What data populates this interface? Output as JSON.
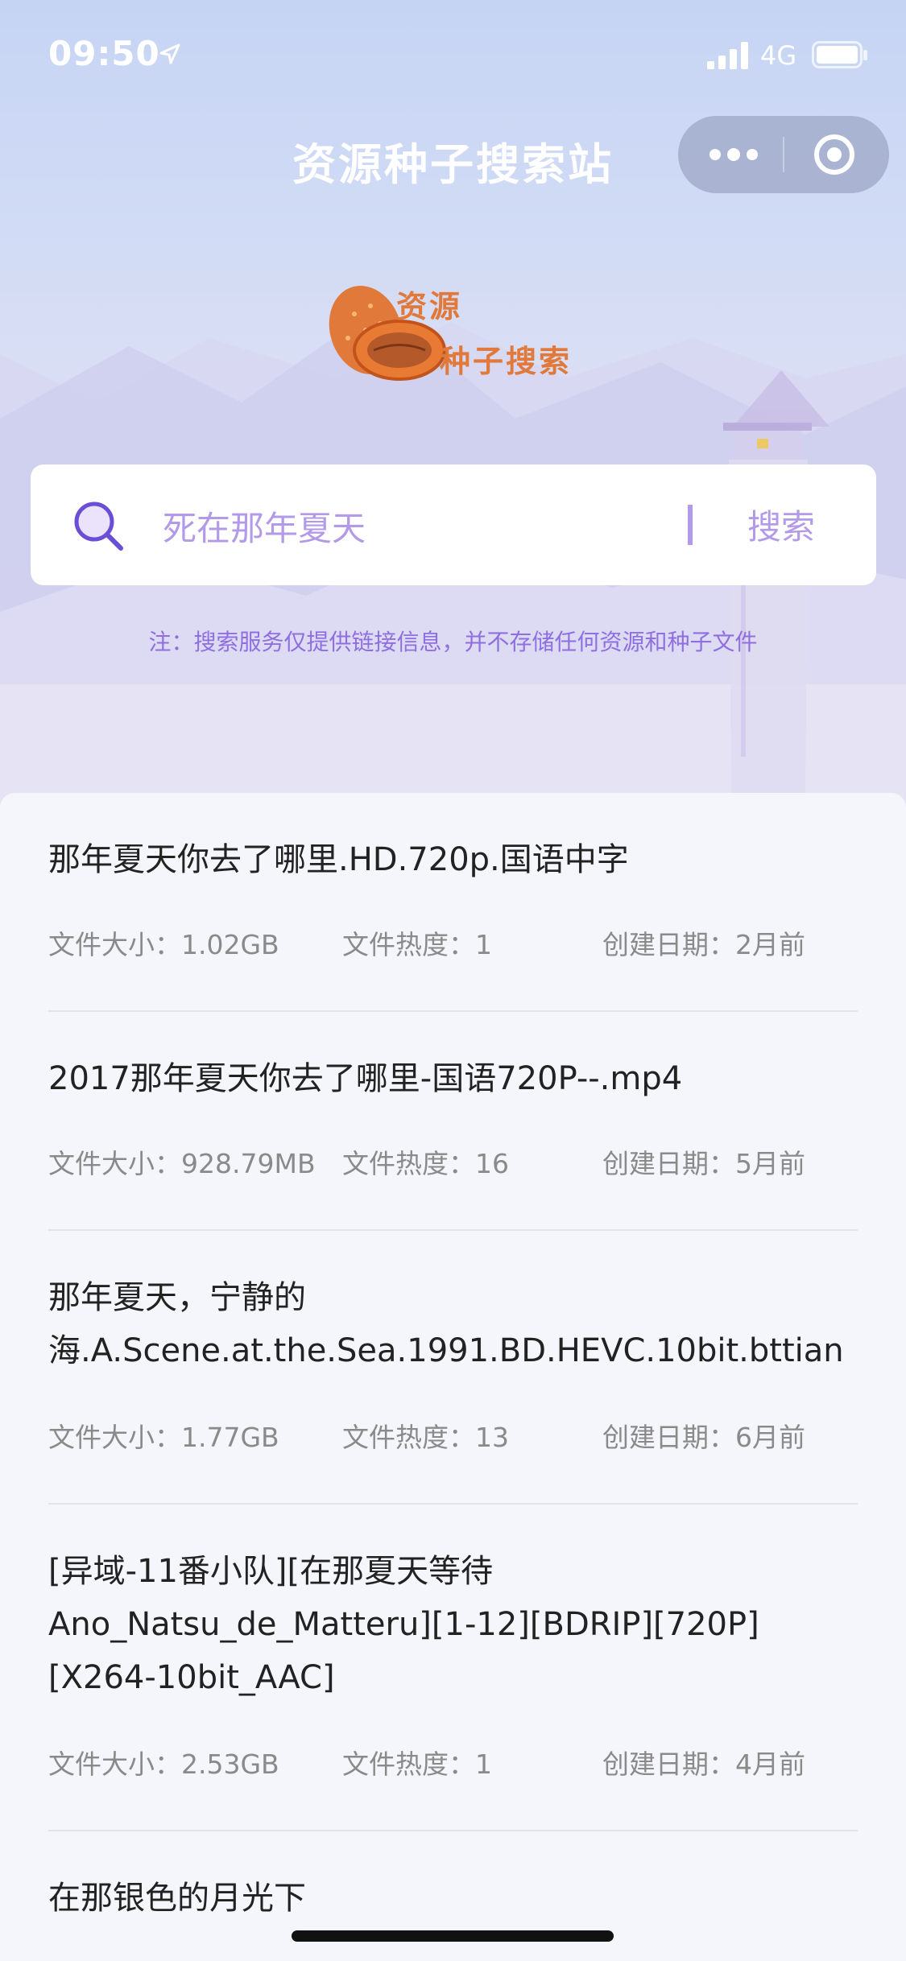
{
  "status_bar": {
    "time": "09:50",
    "network": "4G"
  },
  "nav": {
    "title": "资源种子搜索站"
  },
  "logo": {
    "line1": "资源",
    "line2": "种子搜索"
  },
  "search": {
    "value": "死在那年夏天",
    "button_label": "搜索"
  },
  "note": "注：搜索服务仅提供链接信息，并不存储任何资源和种子文件",
  "meta_labels": {
    "size": "文件大小：",
    "heat": "文件热度：",
    "date": "创建日期："
  },
  "results": [
    {
      "title": "那年夏天你去了哪里.HD.720p.国语中字",
      "size": "1.02GB",
      "heat": "1",
      "date": "2月前"
    },
    {
      "title": "2017那年夏天你去了哪里-国语720P--.mp4",
      "size": "928.79MB",
      "heat": "16",
      "date": "5月前"
    },
    {
      "title": "那年夏天，宁静的\n海.A.Scene.at.the.Sea.1991.BD.HEVC.10bit.bttian",
      "size": "1.77GB",
      "heat": "13",
      "date": "6月前"
    },
    {
      "title": "[异域-11番小队][在那夏天等待\nAno_Natsu_de_Matteru][1-12][BDRIP][720P]\n[X264-10bit_AAC]",
      "size": "2.53GB",
      "heat": "1",
      "date": "4月前"
    },
    {
      "title": "在那银色的月光下"
    }
  ]
}
